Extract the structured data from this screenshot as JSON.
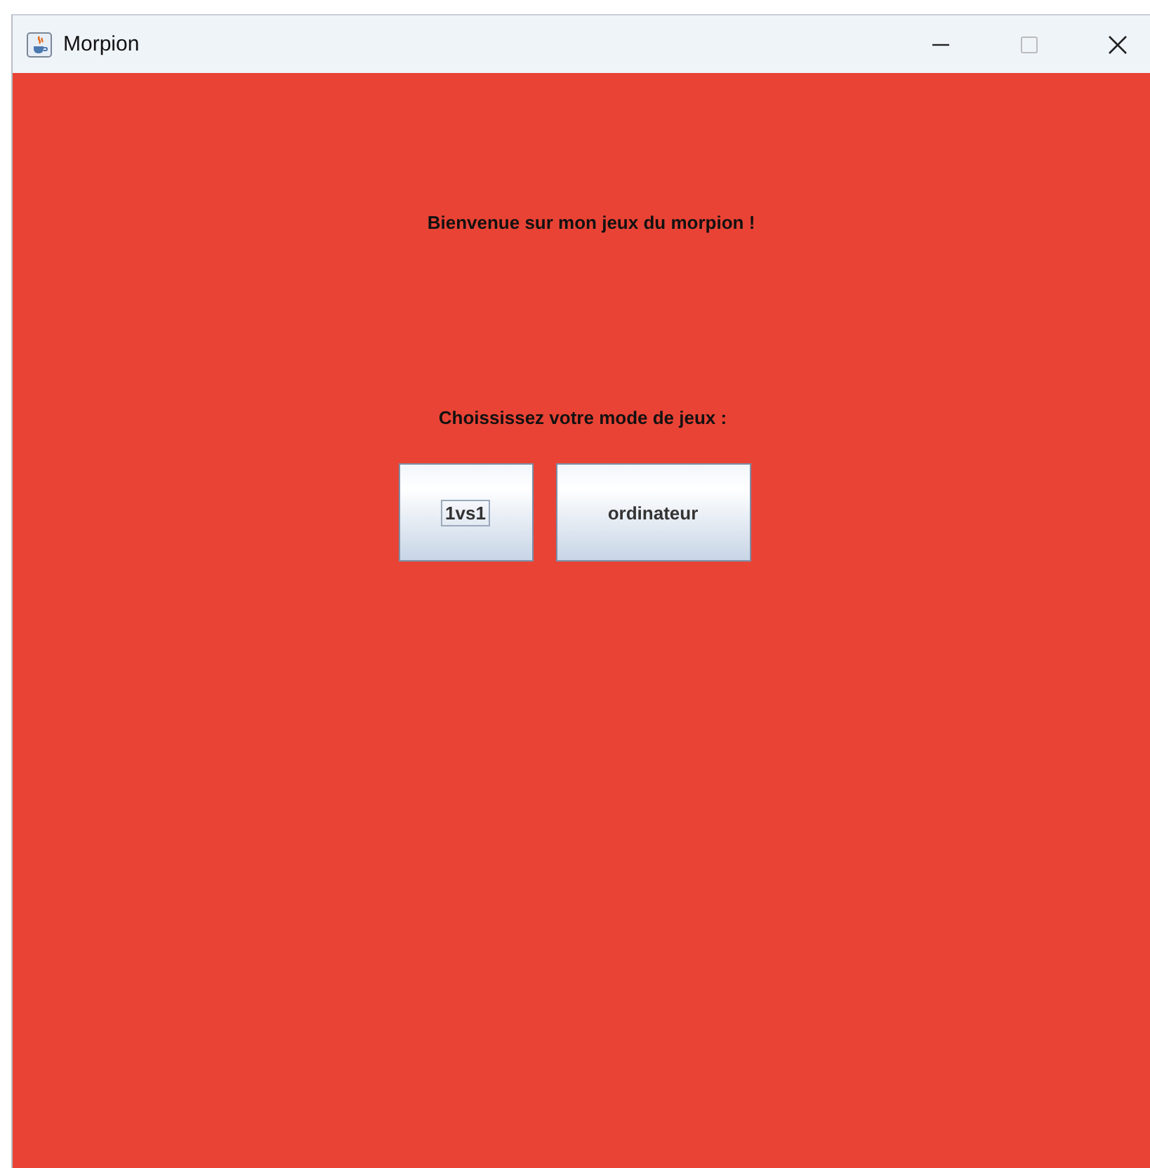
{
  "window": {
    "title": "Morpion"
  },
  "welcome": "Bienvenue sur mon jeux du morpion !",
  "prompt": "Choississez votre mode de jeux :",
  "buttons": [
    {
      "label": "1vs1",
      "focused": true
    },
    {
      "label": "ordinateur",
      "focused": false
    }
  ]
}
